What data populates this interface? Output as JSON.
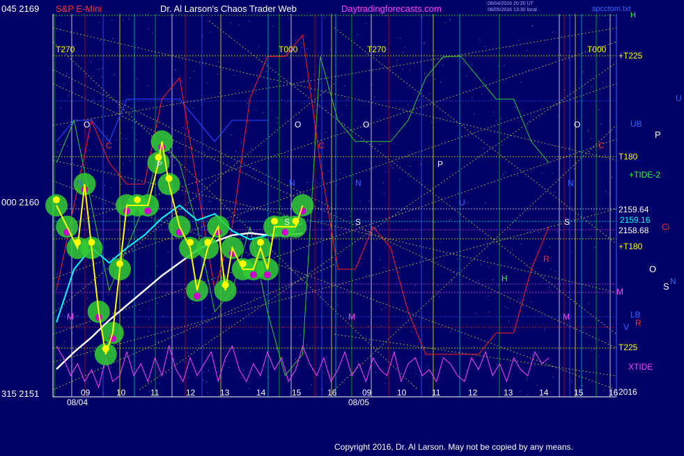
{
  "header": {
    "left_scale": "045 2169",
    "instrument": "S&P E-Mini",
    "title": "Dr. Al Larson's Chaos Trader Web",
    "site": "Daytradingforecasts.com",
    "stamp_line1": "08/04/2016 20:20 UT",
    "stamp_line2": "08/05/2016 13:30 local",
    "brand": "spcctom.txt"
  },
  "left_axis": {
    "mid": "000 2160",
    "bottom": "315 2151"
  },
  "date_labels": [
    "08/04",
    "08/05"
  ],
  "copyright": "Copyright 2016, Dr. Al Larson. May not be copied by any means.",
  "colors": {
    "background": "#000066",
    "price": "#ffff00",
    "cyan_avg": "#00ffff",
    "white_avg": "#ffffff",
    "red_line": "#ff2020",
    "green_line": "#33cc33",
    "magenta": "#ff44ff",
    "fan": "#cccc44"
  },
  "chart_data": {
    "type": "line",
    "title": "S&P E-Mini",
    "ylim": [
      2151,
      2169
    ],
    "yticks": [
      2151,
      2160,
      2169
    ],
    "hour_labels_day1": [
      "09",
      "10",
      "11",
      "12",
      "13",
      "14",
      "15",
      "16"
    ],
    "hour_labels_day2": [
      "09",
      "10",
      "11",
      "12",
      "13",
      "14",
      "15",
      "16"
    ],
    "right_labels": [
      {
        "text": "H",
        "color": "#33ff33"
      },
      {
        "text": "+T225",
        "color": "#ffff00"
      },
      {
        "text": "U",
        "color": "#3366ff"
      },
      {
        "text": "UB",
        "color": "#3366ff"
      },
      {
        "text": "P",
        "color": "#ffffff"
      },
      {
        "text": "T180",
        "color": "#ffff00"
      },
      {
        "text": "+TIDE-2",
        "color": "#33ff33"
      },
      {
        "text": "2159.64",
        "color": "#ffffff"
      },
      {
        "text": "2159.16",
        "color": "#00ffff"
      },
      {
        "text": "2158.68",
        "color": "#ffffff"
      },
      {
        "text": "Ci",
        "color": "#ff3333"
      },
      {
        "text": "+T180",
        "color": "#ffff00"
      },
      {
        "text": "O",
        "color": "#ffffff"
      },
      {
        "text": "S",
        "color": "#ffffff"
      },
      {
        "text": "N",
        "color": "#3366ff"
      },
      {
        "text": "M",
        "color": "#ff44ff"
      },
      {
        "text": "LB",
        "color": "#3366ff"
      },
      {
        "text": "V",
        "color": "#3366ff"
      },
      {
        "text": "R",
        "color": "#ff3333"
      },
      {
        "text": "T225",
        "color": "#ffff00"
      },
      {
        "text": "XTIDE",
        "color": "#ff44ff"
      },
      {
        "text": "2016",
        "color": "#ffffff"
      }
    ],
    "planet_labels": [
      {
        "text": "T270",
        "color": "#ffff00"
      },
      {
        "text": "T000",
        "color": "#ffff00"
      },
      {
        "text": "T270",
        "color": "#ffff00"
      },
      {
        "text": "T000",
        "color": "#ffff00"
      },
      {
        "text": "O",
        "color": "#ffffff"
      },
      {
        "text": "O",
        "color": "#ffffff"
      },
      {
        "text": "O",
        "color": "#ffffff"
      },
      {
        "text": "O",
        "color": "#ffffff"
      },
      {
        "text": "C",
        "color": "#ff3333"
      },
      {
        "text": "C",
        "color": "#ff3333"
      },
      {
        "text": "C",
        "color": "#ff3333"
      },
      {
        "text": "P",
        "color": "#ffffff"
      },
      {
        "text": "P",
        "color": "#ffffff"
      },
      {
        "text": "N",
        "color": "#3366ff"
      },
      {
        "text": "N",
        "color": "#3366ff"
      },
      {
        "text": "N",
        "color": "#3366ff"
      },
      {
        "text": "N",
        "color": "#3366ff"
      },
      {
        "text": "S",
        "color": "#ffffff"
      },
      {
        "text": "S",
        "color": "#ffffff"
      },
      {
        "text": "S",
        "color": "#ffffff"
      },
      {
        "text": "H",
        "color": "#33ff33"
      },
      {
        "text": "H",
        "color": "#33ff33"
      },
      {
        "text": "M",
        "color": "#ff44ff"
      },
      {
        "text": "M",
        "color": "#ff44ff"
      },
      {
        "text": "M",
        "color": "#ff44ff"
      },
      {
        "text": "R",
        "color": "#ff3333"
      },
      {
        "text": "U",
        "color": "#3366ff"
      }
    ],
    "series": [
      {
        "name": "price",
        "x": [
          9.0,
          9.3,
          9.6,
          9.8,
          10.0,
          10.2,
          10.4,
          10.6,
          10.8,
          11.0,
          11.3,
          11.6,
          11.9,
          12.0,
          12.2,
          12.5,
          12.8,
          13.0,
          13.3,
          13.6,
          13.8,
          14.0,
          14.3,
          14.6,
          14.8,
          15.0,
          15.2,
          15.5,
          15.8,
          16.0
        ],
        "y": [
          2160,
          2159,
          2158,
          2161,
          2158,
          2155,
          2153,
          2154,
          2157,
          2160,
          2160,
          2160,
          2162,
          2163,
          2161,
          2159,
          2158,
          2156,
          2158,
          2159,
          2156,
          2158,
          2157,
          2157,
          2158,
          2157,
          2159,
          2159,
          2159,
          2160
        ]
      },
      {
        "name": "cyan",
        "x": [
          9.0,
          9.5,
          10.0,
          10.5,
          11.0,
          11.5,
          12.0,
          12.5,
          13.0,
          13.5,
          14.0,
          14.5,
          15.0,
          15.5,
          16.0
        ],
        "y": [
          2154.5,
          2157,
          2158,
          2157.3,
          2158,
          2158.6,
          2159.4,
          2160,
          2159.3,
          2159.6,
          2158.8,
          2158.4,
          2158.6,
          2158.8,
          2159.16
        ]
      },
      {
        "name": "white",
        "x": [
          9.0,
          9.5,
          10.0,
          10.5,
          11.0,
          11.5,
          12.0,
          12.5,
          13.0,
          13.5,
          14.0,
          14.5,
          15.0,
          15.5,
          16.0
        ],
        "y": [
          2152.3,
          2153.1,
          2153.8,
          2154.6,
          2155.3,
          2156,
          2156.7,
          2157.3,
          2157.9,
          2158.3,
          2158.6,
          2158.7,
          2158.6,
          2158.6,
          2158.68
        ]
      },
      {
        "name": "red",
        "x": [
          9.0,
          9.5,
          10.0,
          10.5,
          11.0,
          11.5,
          12.0,
          12.5,
          13.0,
          13.5,
          14.0,
          14.5,
          15.0,
          15.5,
          16.0,
          16.5,
          17.0,
          17.5,
          18.0,
          18.5,
          19.0,
          19.5,
          20.0,
          20.5,
          21.0,
          21.5,
          22.0,
          22.5,
          23.0
        ],
        "y": [
          2156,
          2160,
          2164,
          2162,
          2161,
          2161,
          2165,
          2166,
          2161,
          2156,
          2159,
          2165,
          2167,
          2167,
          2168,
          2162,
          2157,
          2157,
          2159,
          2158,
          2155,
          2153,
          2153,
          2153,
          2153,
          2154,
          2154,
          2157,
          2159
        ]
      },
      {
        "name": "green",
        "x": [
          9.0,
          9.5,
          10.0,
          10.5,
          11.0,
          11.5,
          12.0,
          12.5,
          13.0,
          13.5,
          14.0,
          14.5,
          15.0,
          15.5,
          16.0,
          16.5,
          17.0,
          17.5,
          18.0,
          18.5,
          19.0,
          19.5,
          20.0,
          20.5,
          21.0,
          21.5,
          22.0,
          22.5,
          23.0
        ],
        "y": [
          2162,
          2164,
          2160,
          2156,
          2158,
          2160,
          2163,
          2162,
          2159,
          2155,
          2156,
          2159,
          2155,
          2152,
          2153,
          2167,
          2164,
          2163,
          2163,
          2163,
          2164,
          2166,
          2167,
          2167,
          2166,
          2165,
          2165,
          2163,
          2162
        ]
      },
      {
        "name": "blue",
        "x": [
          9.0,
          9.5,
          10.0,
          10.5,
          11.0,
          11.5,
          12.0,
          12.5,
          13.0,
          13.5,
          14.0,
          14.5,
          15.0
        ],
        "y": [
          2163,
          2164,
          2164,
          2163,
          2165,
          2165,
          2165,
          2165,
          2164,
          2163,
          2164,
          2164,
          2164
        ]
      },
      {
        "name": "XTIDE",
        "x": [
          9.0,
          9.2,
          9.4,
          9.6,
          9.8,
          10.0,
          10.2,
          10.4,
          10.6,
          10.8,
          11.0,
          11.2,
          11.4,
          11.6,
          11.8,
          12.0,
          12.2,
          12.4,
          12.6,
          12.8,
          13.0,
          13.2,
          13.4,
          13.6,
          13.8,
          14.0,
          14.2,
          14.4,
          14.6,
          14.8,
          15.0,
          15.2,
          15.4,
          15.6,
          15.8,
          16.0,
          16.2,
          16.4,
          16.6,
          16.8,
          17.0,
          17.2,
          17.4,
          17.6,
          17.8,
          18.0,
          18.2,
          18.4,
          18.6,
          18.8,
          19.0,
          19.2,
          19.4,
          19.6,
          19.8,
          20.0,
          20.2,
          20.4,
          20.6,
          20.8,
          21.0,
          21.2,
          21.4,
          21.6,
          21.8,
          22.0,
          22.2,
          22.4,
          22.6,
          22.8,
          23.0
        ],
        "y": [
          0.8,
          0.6,
          0.3,
          0.5,
          0.2,
          0.4,
          0.1,
          0.6,
          0.2,
          0.3,
          0.7,
          0.3,
          0.5,
          0.2,
          0.6,
          0.3,
          0.8,
          0.4,
          0.2,
          0.6,
          0.3,
          0.5,
          0.7,
          0.2,
          0.6,
          0.8,
          0.4,
          0.2,
          0.5,
          0.3,
          0.7,
          0.4,
          0.6,
          0.2,
          0.4,
          0.8,
          0.5,
          0.3,
          0.6,
          0.2,
          0.4,
          0.7,
          0.3,
          0.5,
          0.2,
          0.6,
          0.4,
          0.3,
          0.7,
          0.2,
          0.5,
          0.6,
          0.3,
          0.4,
          0.2,
          0.6,
          0.5,
          0.3,
          0.2,
          0.6,
          0.4,
          0.7,
          0.3,
          0.5,
          0.2,
          0.6,
          0.4,
          0.3,
          0.7,
          0.5,
          0.6
        ]
      }
    ]
  }
}
